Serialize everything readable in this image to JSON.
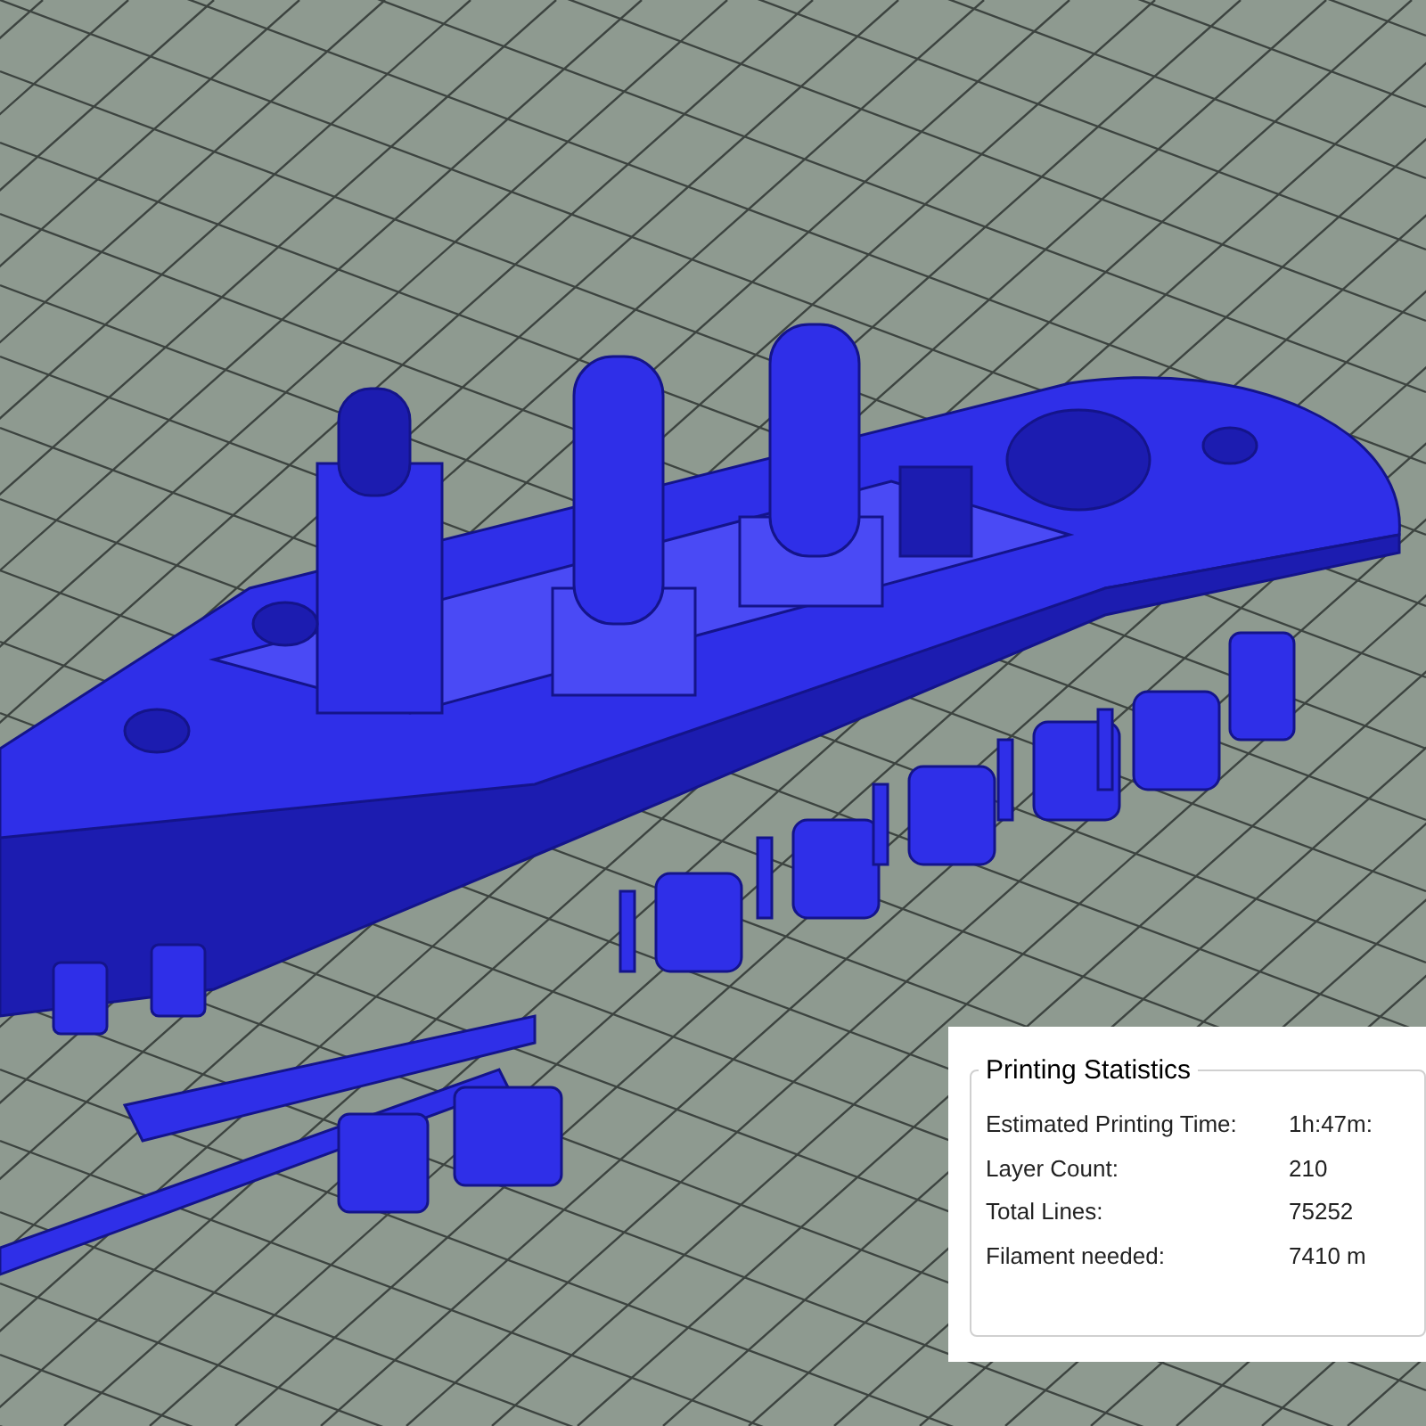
{
  "printing_statistics": {
    "title": "Printing Statistics",
    "rows": [
      {
        "label": "Estimated Printing Time:",
        "value": "1h:47m:"
      },
      {
        "label": "Layer Count:",
        "value": "210"
      },
      {
        "label": "Total Lines:",
        "value": "75252"
      },
      {
        "label": "Filament needed:",
        "value": "7410 m"
      }
    ]
  }
}
